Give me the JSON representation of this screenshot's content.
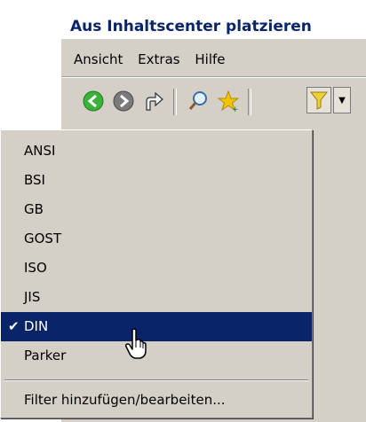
{
  "window": {
    "title": "Aus Inhaltscenter platzieren"
  },
  "menubar": {
    "items": [
      "Ansicht",
      "Extras",
      "Hilfe"
    ]
  },
  "toolbar": {
    "icons": [
      "back-icon",
      "forward-icon",
      "up-folder-icon",
      "search-icon",
      "favorites-star-icon",
      "filter-icon",
      "dropdown-arrow-icon"
    ],
    "colors": {
      "back": "#3ab23a",
      "forward": "#6a6a6a",
      "star": "#f2c400",
      "filter": "#e8d23a"
    }
  },
  "filter_menu": {
    "items": [
      {
        "label": "ANSI",
        "checked": false
      },
      {
        "label": "BSI",
        "checked": false
      },
      {
        "label": "GB",
        "checked": false
      },
      {
        "label": "GOST",
        "checked": false
      },
      {
        "label": "ISO",
        "checked": false
      },
      {
        "label": "JIS",
        "checked": false
      },
      {
        "label": "DIN",
        "checked": true
      },
      {
        "label": "Parker",
        "checked": false
      }
    ],
    "footer": "Filter hinzufügen/bearbeiten...",
    "check_mark": "✔",
    "selection_color": "#0a246a"
  }
}
